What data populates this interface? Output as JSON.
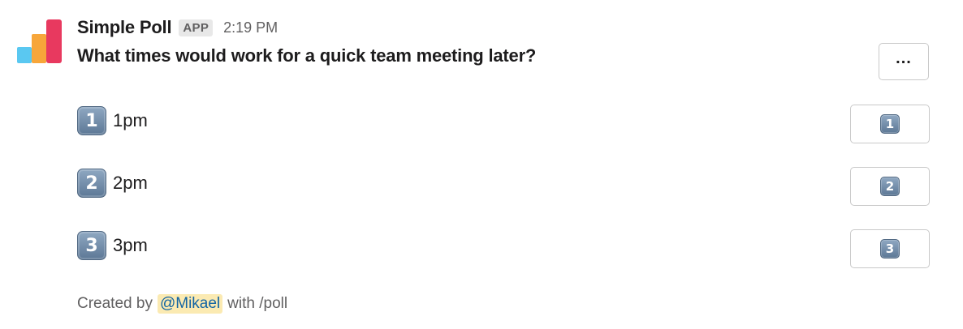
{
  "message": {
    "app_name": "Simple Poll",
    "badge": "APP",
    "timestamp": "2:19 PM",
    "question": "What times would work for a quick team meeting later?",
    "overflow_label": "...",
    "options": [
      {
        "number": "1",
        "label": "1pm"
      },
      {
        "number": "2",
        "label": "2pm"
      },
      {
        "number": "3",
        "label": "3pm"
      }
    ],
    "footer": {
      "prefix": "Created by",
      "mention": "@Mikael",
      "suffix": "with /poll"
    }
  },
  "colors": {
    "logo_red": "#e8395f",
    "logo_orange": "#f7a63a",
    "logo_blue": "#5ac8f1",
    "mention_bg": "#fbeab2",
    "mention_text": "#1264a3",
    "keycap": "#6f89a6"
  },
  "icons": {
    "avatar": "bar-chart-logo-icon",
    "keycap": "keycap-number-icon"
  }
}
